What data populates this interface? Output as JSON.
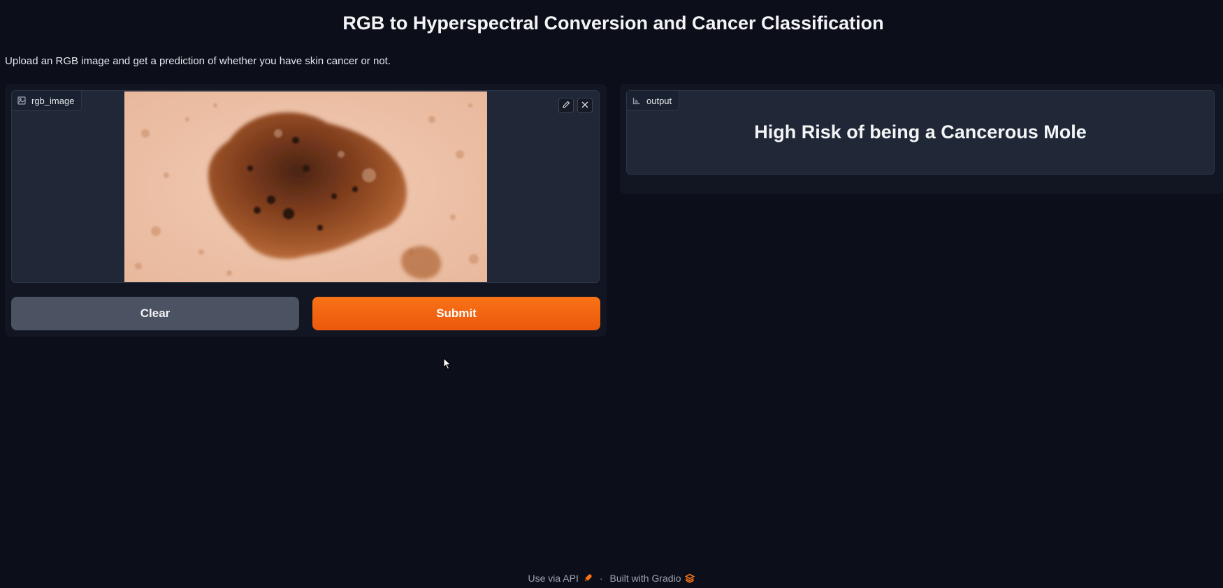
{
  "header": {
    "title": "RGB to Hyperspectral Conversion and Cancer Classification",
    "description": "Upload an RGB image and get a prediction of whether you have skin cancer or not."
  },
  "input": {
    "label": "rgb_image",
    "label_icon": "image-icon",
    "tools": [
      "pencil-icon",
      "close-icon"
    ]
  },
  "buttons": {
    "clear": "Clear",
    "submit": "Submit"
  },
  "output": {
    "label": "output",
    "label_icon": "label-icon",
    "text": "High Risk of being a Cancerous Mole"
  },
  "footer": {
    "api": "Use via API",
    "separator": "·",
    "built": "Built with Gradio"
  },
  "colors": {
    "background": "#0c0f1a",
    "panel": "#202837",
    "accent": "#f97316",
    "secondary_button": "#4b5261"
  }
}
